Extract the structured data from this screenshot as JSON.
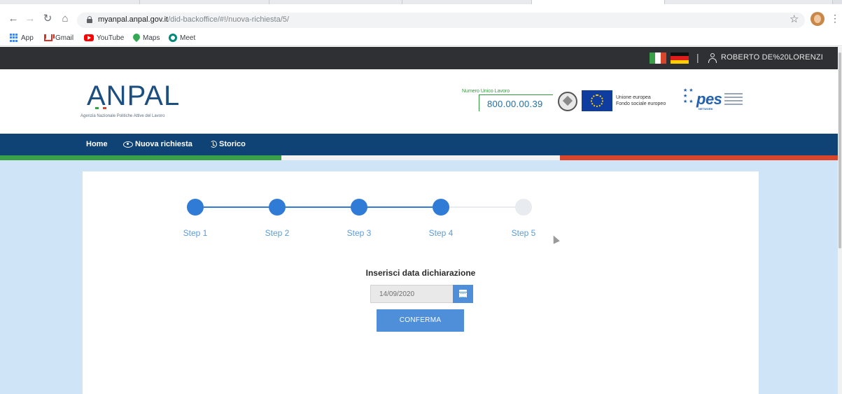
{
  "browser": {
    "url_host": "myanpal.anpal.gov.it",
    "url_path": "/did-backoffice/#!/nuova-richiesta/5/",
    "bookmarks": [
      "App",
      "Gmail",
      "YouTube",
      "Maps",
      "Meet"
    ]
  },
  "topbar": {
    "separator": "|",
    "user_name": "ROBERTO DE%20LORENZI"
  },
  "header": {
    "logo_text": "ANPAL",
    "logo_subtitle": "Agenzia Nazionale Politiche Attive del Lavoro",
    "helpline_label": "Numero Unico Lavoro",
    "helpline_number": "800.00.00.39",
    "eu_line1": "Unione europea",
    "eu_line2": "Fondo sociale europeo",
    "pes_logo": "pes",
    "pes_network": "NETWORK"
  },
  "nav": {
    "home": "Home",
    "new_request": "Nuova richiesta",
    "history": "Storico"
  },
  "stepper": {
    "steps": [
      {
        "label": "Step 1",
        "completed": true
      },
      {
        "label": "Step 2",
        "completed": true
      },
      {
        "label": "Step 3",
        "completed": true
      },
      {
        "label": "Step 4",
        "completed": true
      },
      {
        "label": "Step 5",
        "completed": false
      }
    ],
    "current_step": 4
  },
  "form": {
    "title": "Inserisci data dichiarazione",
    "date_value": "14/09/2020",
    "confirm_label": "CONFERMA"
  },
  "colors": {
    "primary": "#4f8fd9",
    "navbar": "#0f4275",
    "topbar": "#2f3033",
    "page_bg": "#cfe4f7",
    "step_active": "#2f7bd6",
    "step_inactive": "#e8ebef",
    "italy_green": "#3aa047",
    "italy_red": "#d9452b"
  }
}
